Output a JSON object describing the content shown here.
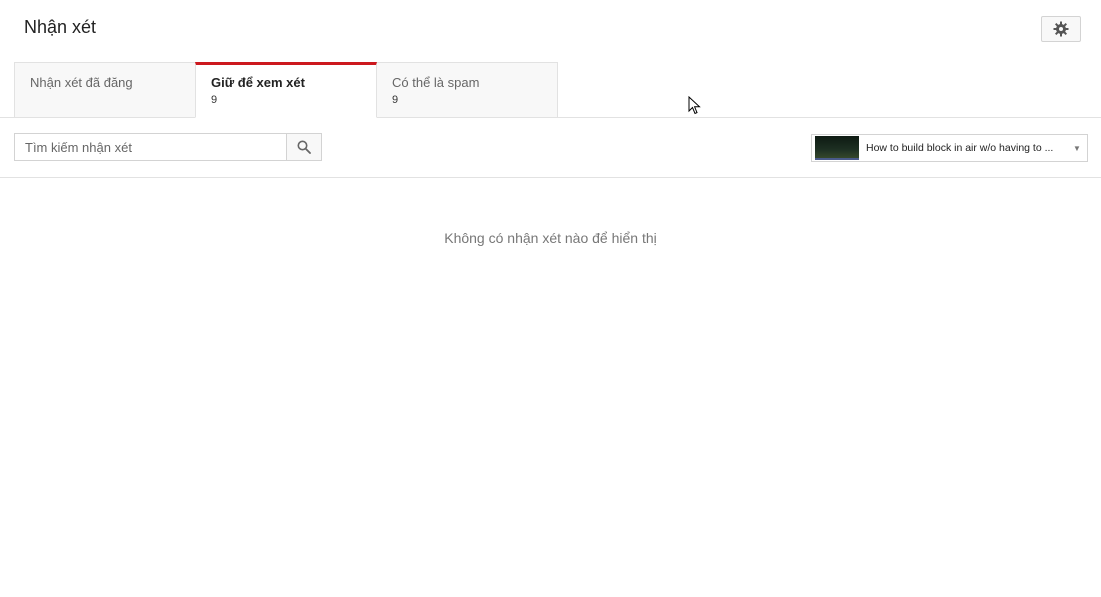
{
  "header": {
    "title": "Nhận xét",
    "settings_icon": "gear-icon"
  },
  "tabs": [
    {
      "label": "Nhận xét đã đăng",
      "count": ""
    },
    {
      "label": "Giữ để xem xét",
      "count": "9",
      "active": true
    },
    {
      "label": "Có thể là spam",
      "count": "9"
    }
  ],
  "search": {
    "placeholder": "Tìm kiếm nhận xét",
    "value": "",
    "button_icon": "search-icon"
  },
  "video_filter": {
    "selected_title": "How to build block in air w/o having to ...",
    "arrow_icon": "chevron-down-icon"
  },
  "main": {
    "empty_message": "Không có nhận xét nào để hiển thị"
  },
  "colors": {
    "active_tab_accent": "#cc181e",
    "border": "#e2e2e2",
    "muted_text": "#777777"
  }
}
